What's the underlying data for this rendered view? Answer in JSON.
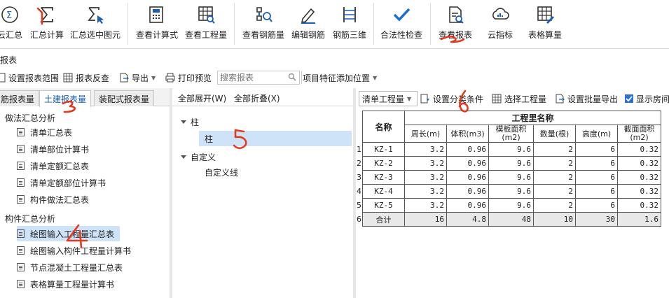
{
  "ribbon": {
    "buttons": [
      {
        "name": "cloud-summary",
        "label": "云汇总",
        "icon": "sigma-cloud-icon"
      },
      {
        "name": "summary-calc",
        "label": "汇总计算",
        "icon": "sigma-icon"
      },
      {
        "name": "summary-selected",
        "label": "汇总选中图元",
        "icon": "sigma-cursor-icon"
      },
      {
        "name": "view-formula",
        "label": "查看计算式",
        "icon": "calculator-icon"
      },
      {
        "name": "view-quantity",
        "label": "查看工程量",
        "icon": "grid-search-icon"
      },
      {
        "name": "view-rebar",
        "label": "查看钢筋量",
        "icon": "rebar-search-icon"
      },
      {
        "name": "edit-rebar",
        "label": "编辑钢筋",
        "icon": "pencil-icon"
      },
      {
        "name": "rebar-3d",
        "label": "钢筋三维",
        "icon": "rebar-3d-icon"
      },
      {
        "name": "legality-check",
        "label": "合法性检查",
        "icon": "checkmark-icon"
      },
      {
        "name": "view-report",
        "label": "查看报表",
        "icon": "report-icon"
      },
      {
        "name": "cloud-index",
        "label": "云指标",
        "icon": "cloud-gauge-icon"
      },
      {
        "name": "table-calc",
        "label": "表格算量",
        "icon": "table-edit-icon"
      }
    ]
  },
  "title": "报表",
  "toolbar": {
    "set_range": "设置报表范围",
    "reverse_check": "报表反查",
    "export": "导出",
    "print_preview": "打印预览",
    "search_placeholder": "搜索报表",
    "add_feature": "项目特征添加位置"
  },
  "left": {
    "tabs": [
      "筋报表量",
      "土建报表量",
      "装配式报表量"
    ],
    "active_tab": 1,
    "group1": "做法汇总分析",
    "group1_items": [
      "清单汇总表",
      "清单部位计算书",
      "清单定额汇总表",
      "清单定额部位计算书",
      "构件做法汇总表"
    ],
    "group2": "构件汇总分析",
    "group2_items": [
      "绘图输入工程量汇总表",
      "绘图输入构件工程量计算书",
      "节点混凝土工程量汇总表",
      "表格算量工程量计算书"
    ],
    "selected_item": "绘图输入工程量汇总表"
  },
  "middle": {
    "expand_all": "全部展开(W)",
    "collapse_all": "全部折叠(X)",
    "node1": "柱",
    "node1_child": "柱",
    "node2": "自定义",
    "node2_child": "自定义线"
  },
  "right": {
    "dropdown_value": "清单工程量",
    "set_filter": "设置分类条件",
    "select_quantity": "选择工程量",
    "batch_export": "设置批量导出",
    "show_rooms": "显示房间",
    "table": {
      "name_header": "名称",
      "group_header": "工程里名称",
      "columns": [
        "周长(m)",
        "体积(m3)",
        "模板面积(m2)",
        "数量(根)",
        "高度(m)",
        "截面面积(m2)"
      ],
      "rows": [
        {
          "n": "1",
          "name": "KZ-1",
          "v": [
            "3.2",
            "0.96",
            "9.6",
            "2",
            "6",
            "0.32"
          ]
        },
        {
          "n": "2",
          "name": "KZ-2",
          "v": [
            "3.2",
            "0.96",
            "9.6",
            "2",
            "6",
            "0.32"
          ]
        },
        {
          "n": "3",
          "name": "KZ-3",
          "v": [
            "3.2",
            "0.96",
            "9.6",
            "2",
            "6",
            "0.32"
          ]
        },
        {
          "n": "4",
          "name": "KZ-4",
          "v": [
            "3.2",
            "0.96",
            "9.6",
            "2",
            "6",
            "0.32"
          ]
        },
        {
          "n": "5",
          "name": "KZ-5",
          "v": [
            "3.2",
            "0.96",
            "9.6",
            "2",
            "6",
            "0.32"
          ]
        }
      ],
      "total": {
        "n": "6",
        "name": "合计",
        "v": [
          "16",
          "4.8",
          "48",
          "10",
          "30",
          "1.6"
        ]
      }
    }
  },
  "colors": {
    "accent": "#1a5fb4",
    "annotation": "#e23a1e",
    "selection": "#cfe3f8"
  }
}
